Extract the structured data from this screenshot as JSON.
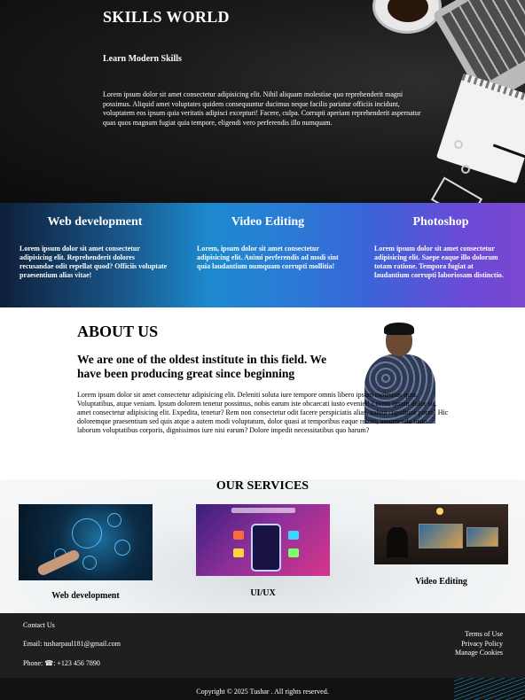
{
  "hero": {
    "title": "SKILLS WORLD",
    "subtitle": "Learn Modern Skills",
    "paragraph": "Lorem ipsum dolor sit amet consectetur adipisicing elit. Nihil aliquam molestiae quo reprehenderit magni possimus. Aliquid amet voluptates quidem consequuntur ducimus neque facilis pariatur officiis incidunt, voluptatem eos ipsum quia veritatis adipisci excepturi! Facere, culpa. Corrupti aperiam reprehenderit aspernatur quas quos magnam fugiat quia tempore, eligendi vero perferendis illo numquam."
  },
  "skills": [
    {
      "title": "Web development",
      "text": "Lorem ipsum dolor sit amet consectetur adipisicing elit. Reprehenderit dolores recusandae odit repellat quod? Officiis voluptate praesentium alias vitae!"
    },
    {
      "title": "Video Editing",
      "text": "Lorem, ipsum dolor sit amet consectetur adipisicing elit. Animi perferendis ad modi sint quia laudantium numquam corrupti mollitia!"
    },
    {
      "title": "Photoshop",
      "text": "Lorem ipsum dolor sit amet consectetur adipisicing elit. Saepe eaque illo dolorum totam ratione. Tempora fugiat at laudantium corrupti laboriosam distinctio."
    }
  ],
  "about": {
    "heading": "ABOUT US",
    "subheading": "We are one of the oldest institute in this field. We have been producing great since beginning",
    "paragraph": "Lorem ipsum dolor sit amet consectetur adipisicing elit. Deleniti soluta iure tempore omnis libero ipsum molestias quia. Voluptatibus, atque veniam. Ipsum dolorem tenetur possimus, nobis earum iste obcaecati iusto eveniet! Lorem ipsum dolor sit, amet consectetur adipisicing elit. Expedita, tenetur? Rem non consectetur odit facere perspiciatis alias, soluta cupiditate porro! Hic doloremque praesentium sed quis atque a autem modi voluptatum, dolor quasi at temporibus eaque rerum, assumenda iusto laborum voluptatibus corporis, dignissimos iure nisi earum? Dolore impedit necessitatibus quo harum?"
  },
  "services": {
    "heading": "OUR SERVICES",
    "items": [
      {
        "caption": "Web development"
      },
      {
        "caption": "UI/UX"
      },
      {
        "caption": "Video Editing"
      }
    ]
  },
  "footer": {
    "contact_label": "Contact Us",
    "email": "Email: tusharpaul181@gmail.com",
    "phone": "Phone: ☎: +123 456 7890",
    "links": [
      "Terms of Use",
      "Privacy Policy",
      "Manage Cookies"
    ],
    "copyright": "Copyright © 2025 Tushar . All rights reserved."
  }
}
